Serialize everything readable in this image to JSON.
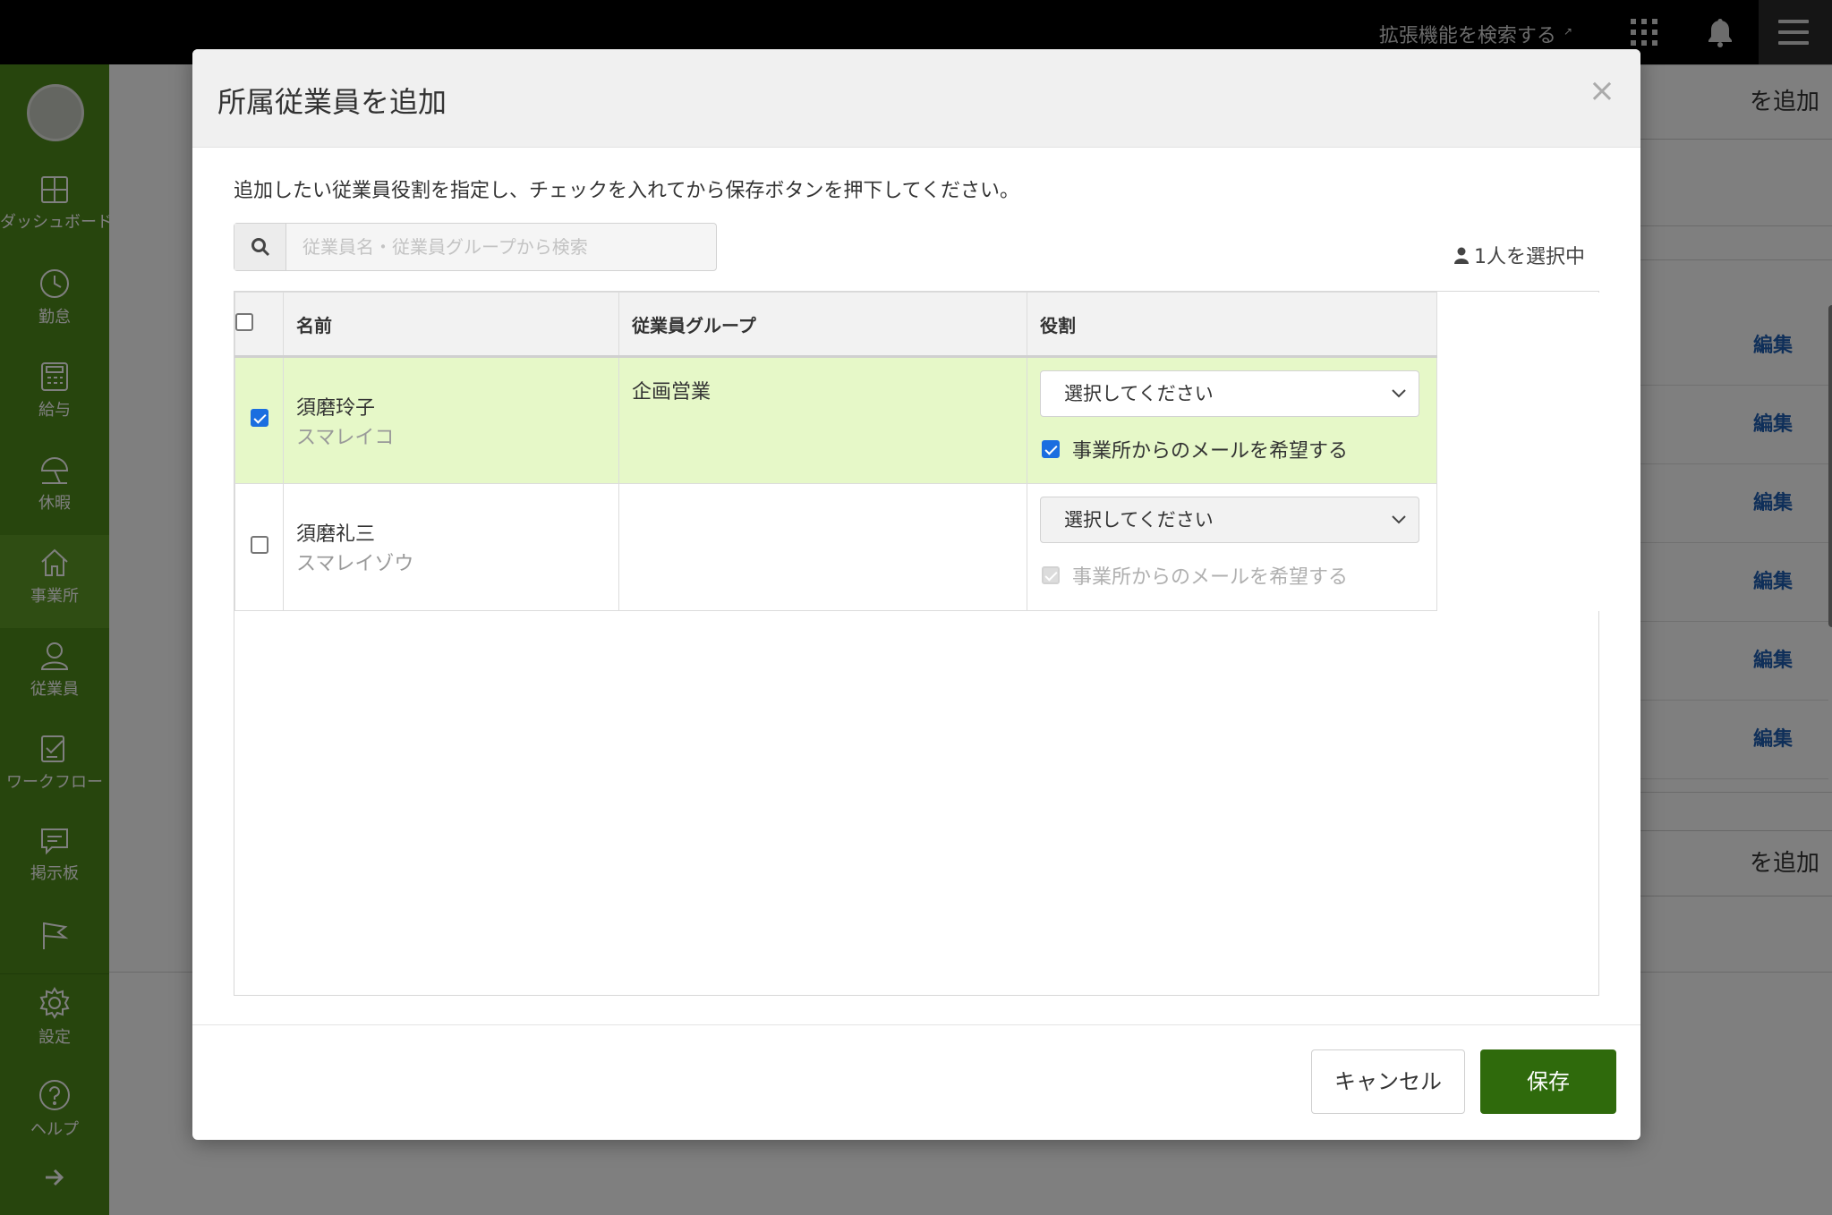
{
  "topbar": {
    "extension_search": "拡張機能を検索する",
    "extension_icon": "external-link-icon",
    "apps_icon": "grid-icon",
    "bell_icon": "bell-icon",
    "menu_icon": "hamburger-icon"
  },
  "sidebar": {
    "items": [
      {
        "label": "ダッシュボード",
        "icon": "dashboard-icon"
      },
      {
        "label": "勤怠",
        "icon": "clock-icon"
      },
      {
        "label": "給与",
        "icon": "calculator-icon"
      },
      {
        "label": "休暇",
        "icon": "parasol-icon"
      },
      {
        "label": "事業所",
        "icon": "home-icon"
      },
      {
        "label": "従業員",
        "icon": "person-icon"
      },
      {
        "label": "ワークフロー",
        "icon": "checklist-icon"
      },
      {
        "label": "掲示板",
        "icon": "chat-icon"
      },
      {
        "label": "",
        "icon": "flag-icon"
      },
      {
        "label": "設定",
        "icon": "gear-icon"
      },
      {
        "label": "ヘルプ",
        "icon": "help-icon"
      },
      {
        "label": "",
        "icon": "arrow-right-icon"
      }
    ]
  },
  "background": {
    "add_button_label": "を追加",
    "edit_link_label": "編集"
  },
  "modal": {
    "title": "所属従業員を追加",
    "close_label": "×",
    "description": "追加したい従業員役割を指定し、チェックを入れてから保存ボタンを押下してください。",
    "search_placeholder": "従業員名・従業員グループから検索",
    "selected_count": "1人を選択中",
    "columns": {
      "name": "名前",
      "group": "従業員グループ",
      "role": "役割"
    },
    "rows": [
      {
        "checked": true,
        "name": "須磨玲子",
        "kana": "スマレイコ",
        "group": "企画営業",
        "role_placeholder": "選択してください",
        "mail_label": "事業所からのメールを希望する",
        "mail_checked": true,
        "mail_disabled": false
      },
      {
        "checked": false,
        "name": "須磨礼三",
        "kana": "スマレイゾウ",
        "group": "",
        "role_placeholder": "選択してください",
        "mail_label": "事業所からのメールを希望する",
        "mail_checked": true,
        "mail_disabled": true
      }
    ],
    "cancel_label": "キャンセル",
    "save_label": "保存"
  },
  "colors": {
    "sidebar_green": "#4f8a1b",
    "save_button": "#2f6a0c",
    "selected_row": "#e6f8c8",
    "checkbox_blue": "#1a6ee0",
    "link_blue": "#1f5fb3"
  }
}
